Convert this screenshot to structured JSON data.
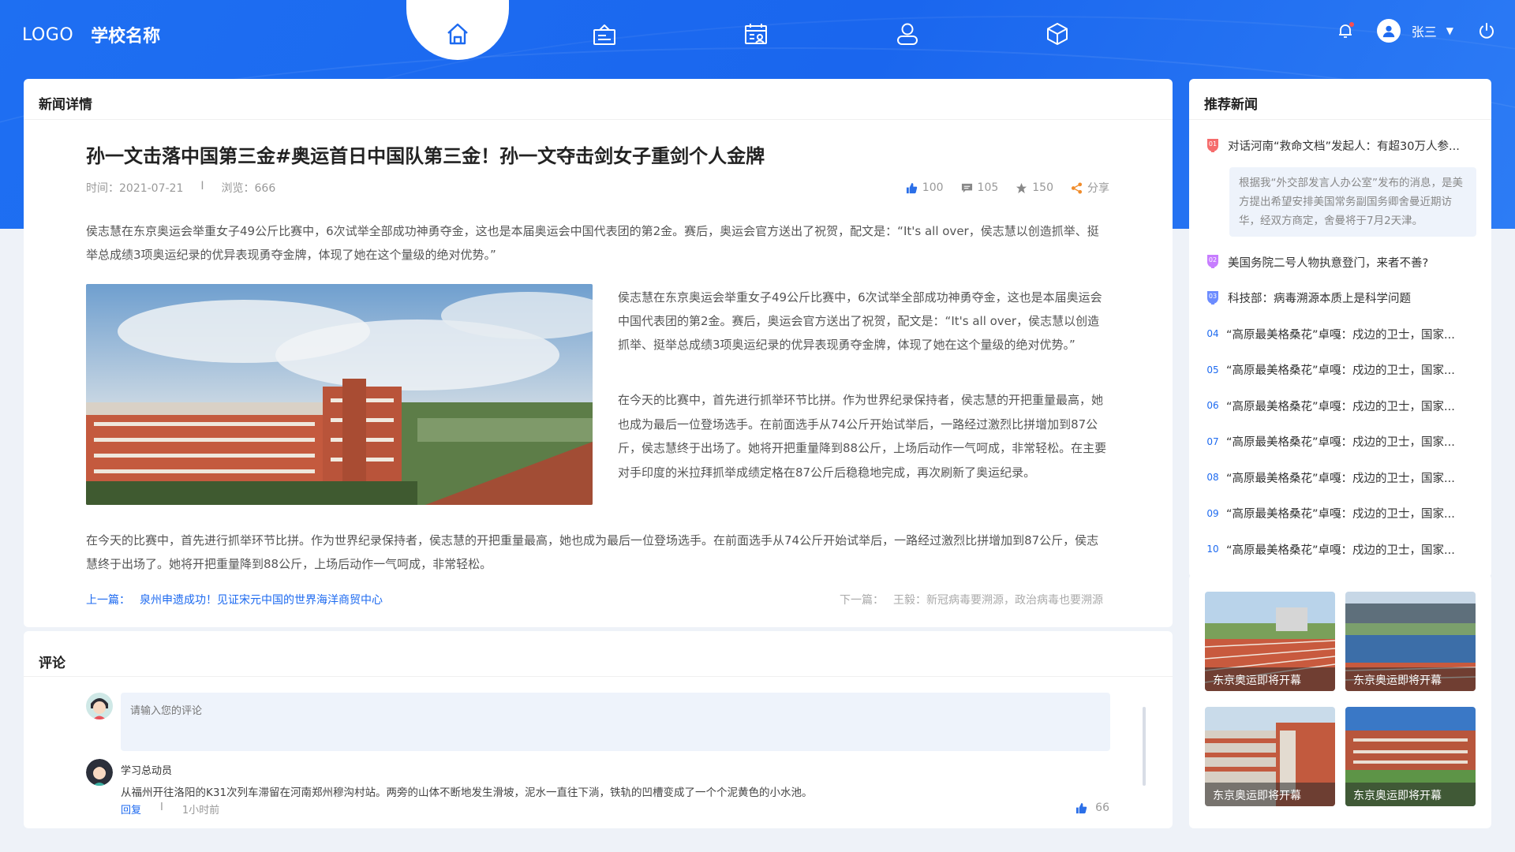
{
  "header": {
    "logo": "LOGO",
    "school": "学校名称",
    "nav": [
      {
        "name": "home",
        "icon": "home-icon",
        "active": true
      },
      {
        "name": "certificate",
        "icon": "certificate-icon",
        "active": false
      },
      {
        "name": "schedule",
        "icon": "calendar-icon",
        "active": false
      },
      {
        "name": "profile",
        "icon": "user-icon",
        "active": false
      },
      {
        "name": "resources",
        "icon": "cube-icon",
        "active": false
      }
    ],
    "user_name": "张三",
    "caret": "▼"
  },
  "article": {
    "panel_title": "新闻详情",
    "title": "孙一文击落中国第三金#奥运首日中国队第三金！孙一文夺击剑女子重剑个人金牌",
    "time": "时间：2021-07-21",
    "separator": "I",
    "views": "浏览：666",
    "likes": "100",
    "comments": "105",
    "favorites": "150",
    "share": "分享",
    "para1": "侯志慧在东京奥运会举重女子49公斤比赛中，6次试举全部成功神勇夺金，这也是本届奥运会中国代表团的第2金。赛后，奥运会官方送出了祝贺，配文是：“It's all over，侯志慧以创造抓举、挺举总成绩3项奥运纪录的优异表现勇夺金牌，体现了她在这个量级的绝对优势。”",
    "para2": "侯志慧在东京奥运会举重女子49公斤比赛中，6次试举全部成功神勇夺金，这也是本届奥运会中国代表团的第2金。赛后，奥运会官方送出了祝贺，配文是：“It's all over，侯志慧以创造抓举、挺举总成绩3项奥运纪录的优异表现勇夺金牌，体现了她在这个量级的绝对优势。”",
    "para3": "在今天的比赛中，首先进行抓举环节比拼。作为世界纪录保持者，侯志慧的开把重量最高，她也成为最后一位登场选手。在前面选手从74公斤开始试举后，一路经过激烈比拼增加到87公斤，侯志慧终于出场了。她将开把重量降到88公斤，上场后动作一气呵成，非常轻松。在主要对手印度的米拉拜抓举成绩定格在87公斤后稳稳地完成，再次刷新了奥运纪录。",
    "para4": "在今天的比赛中，首先进行抓举环节比拼。作为世界纪录保持者，侯志慧的开把重量最高，她也成为最后一位登场选手。在前面选手从74公斤开始试举后，一路经过激烈比拼增加到87公斤，侯志慧终于出场了。她将开把重量降到88公斤，上场后动作一气呵成，非常轻松。",
    "prev_label": "上一篇：",
    "prev_title": "泉州申遗成功！见证宋元中国的世界海洋商贸中心",
    "next_label": "下一篇：",
    "next_title": "王毅：新冠病毒要溯源，政治病毒也要溯源"
  },
  "comments": {
    "panel_title": "评论",
    "placeholder": "请输入您的评论",
    "items": [
      {
        "user": "学习总动员",
        "text": "从福州开往洛阳的K31次列车滞留在河南郑州穆沟村站。两旁的山体不断地发生滑坡，泥水一直往下淌，铁轨的凹槽变成了一个个泥黄色的小水池。",
        "reply": "回复",
        "separator": "I",
        "time": "1小时前",
        "likes": "66"
      }
    ]
  },
  "recommend": {
    "panel_title": "推荐新闻",
    "items": [
      {
        "rank": "01",
        "title": "对话河南“救命文档”发起人：有超30万人参...",
        "summary": "根据我“外交部发言人办公室”发布的消息，是美方提出希望安排美国常务副国务卿舍曼近期访华，经双方商定，舍曼将于7月2天津。",
        "badge_color": "#f56c6c"
      },
      {
        "rank": "02",
        "title": "美国务院二号人物执意登门，来者不善?",
        "badge_color": "#c77dff"
      },
      {
        "rank": "03",
        "title": "科技部：病毒溯源本质上是科学问题",
        "badge_color": "#6c8cff"
      },
      {
        "rank": "04",
        "title": "“高原最美格桑花”卓嘎：戍边的卫士，国家..."
      },
      {
        "rank": "05",
        "title": "“高原最美格桑花”卓嘎：戍边的卫士，国家..."
      },
      {
        "rank": "06",
        "title": "“高原最美格桑花”卓嘎：戍边的卫士，国家..."
      },
      {
        "rank": "07",
        "title": "“高原最美格桑花”卓嘎：戍边的卫士，国家..."
      },
      {
        "rank": "08",
        "title": "“高原最美格桑花”卓嘎：戍边的卫士，国家..."
      },
      {
        "rank": "09",
        "title": "“高原最美格桑花”卓嘎：戍边的卫士，国家..."
      },
      {
        "rank": "10",
        "title": "“高原最美格桑花”卓嘎：戍边的卫士，国家..."
      }
    ]
  },
  "gallery": [
    {
      "caption": "东京奥运即将开幕"
    },
    {
      "caption": "东京奥运即将开幕"
    },
    {
      "caption": "东京奥运即将开幕"
    },
    {
      "caption": "东京奥运即将开幕"
    }
  ],
  "colors": {
    "primary": "#1d6af0",
    "header_bg": "#1e6ff2",
    "page_bg": "#eef2f8"
  }
}
